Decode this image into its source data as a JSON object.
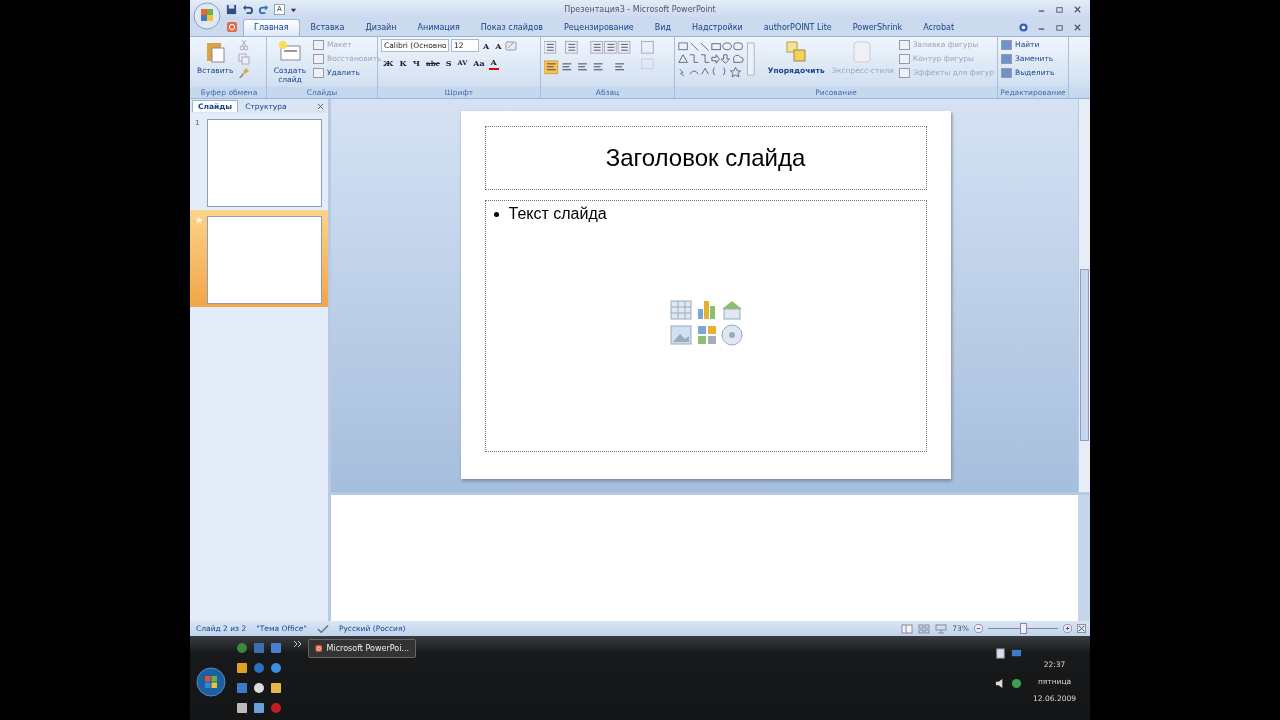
{
  "window": {
    "title": "Презентация3 - Microsoft PowerPoint"
  },
  "quick_access": {
    "text": "A"
  },
  "tabs": [
    {
      "label": "Главная",
      "selected": true
    },
    {
      "label": "Вставка",
      "selected": false
    },
    {
      "label": "Дизайн",
      "selected": false
    },
    {
      "label": "Анимация",
      "selected": false
    },
    {
      "label": "Показ слайдов",
      "selected": false
    },
    {
      "label": "Рецензирование",
      "selected": false
    },
    {
      "label": "Вид",
      "selected": false
    },
    {
      "label": "Надстройки",
      "selected": false
    },
    {
      "label": "authorPOINT Lite",
      "selected": false
    },
    {
      "label": "PowerShrink",
      "selected": false
    },
    {
      "label": "Acrobat",
      "selected": false
    }
  ],
  "ribbon": {
    "groups": [
      {
        "kind": "clipboard",
        "title": "Буфер обмена",
        "paste_label": "Вставить"
      },
      {
        "kind": "slides",
        "title": "Слайды",
        "new_slide": "Создать слайд",
        "buttons": [
          {
            "label": "Макет",
            "disabled": true
          },
          {
            "label": "Восстановить",
            "disabled": true
          },
          {
            "label": "Удалить",
            "disabled": false
          }
        ]
      },
      {
        "kind": "font",
        "title": "Шрифт",
        "font_name": "Calibri (Основно",
        "font_size": "12",
        "size_buttons": [
          "A",
          "A"
        ],
        "format_buttons": [
          "Ж",
          "К",
          "Ч",
          "abc",
          "S",
          "AV",
          "Aa"
        ],
        "color_button": "A"
      },
      {
        "kind": "paragraph",
        "title": "Абзац"
      },
      {
        "kind": "drawing",
        "title": "Рисование",
        "arrange": "Упорядочить",
        "quick_styles": {
          "label": "Экспресс-стили",
          "disabled": true
        },
        "buttons": [
          {
            "label": "Заливка фигуры",
            "disabled": true
          },
          {
            "label": "Контур фигуры",
            "disabled": true
          },
          {
            "label": "Эффекты для фигур",
            "disabled": true
          }
        ]
      },
      {
        "kind": "editing",
        "title": "Редактирование",
        "buttons": [
          {
            "label": "Найти"
          },
          {
            "label": "Заменить"
          },
          {
            "label": "Выделить"
          }
        ]
      }
    ]
  },
  "slides_pane": {
    "tabs": [
      {
        "label": "Слайды",
        "selected": true
      },
      {
        "label": "Структура",
        "selected": false
      }
    ],
    "thumbnails": [
      {
        "number": "1",
        "selected": false
      },
      {
        "selected": true
      }
    ]
  },
  "slide": {
    "title": "Заголовок слайда",
    "bullets": [
      "Текст слайда"
    ]
  },
  "status_bar": {
    "items": [
      "Слайд 2 из 2",
      "\"Тема Office\"",
      "Русский (Россия)"
    ],
    "zoom": "73%",
    "zoom_level": {
      "level": 0.5
    }
  },
  "taskbar": {
    "task": {
      "label": "Microsoft PowerPoi..."
    },
    "time": "22:37",
    "day": "пятница",
    "date": "12.06.2009"
  }
}
